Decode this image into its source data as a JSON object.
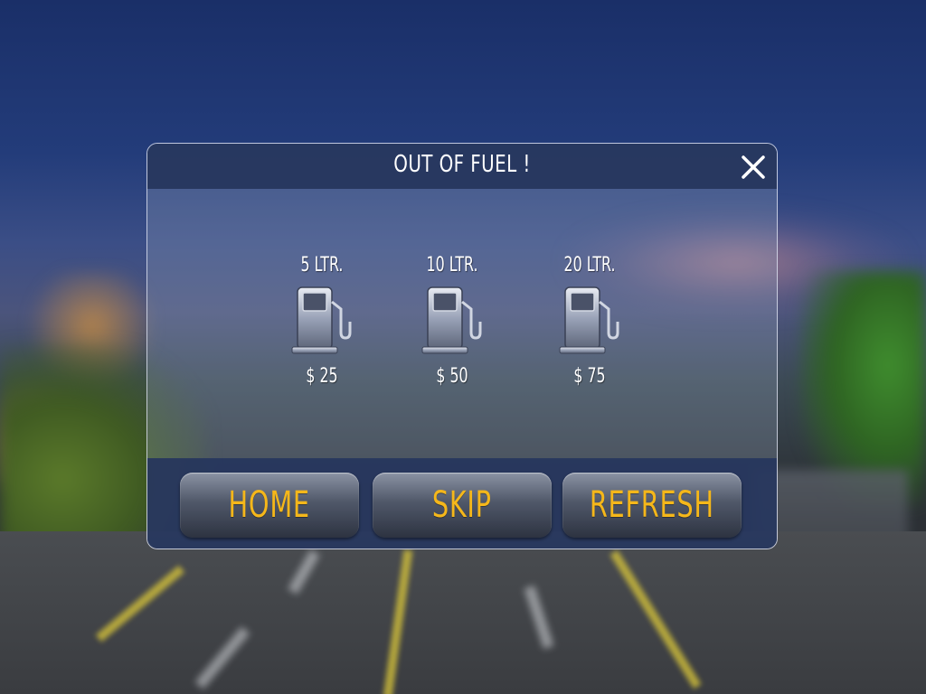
{
  "dialog": {
    "title": "OUT OF FUEL !",
    "close_icon": "close-icon"
  },
  "fuel_options": [
    {
      "label": "5 LTR.",
      "price": "$ 25",
      "icon": "fuel-pump-icon"
    },
    {
      "label": "10 LTR.",
      "price": "$ 50",
      "icon": "fuel-pump-icon"
    },
    {
      "label": "20 LTR.",
      "price": "$ 75",
      "icon": "fuel-pump-icon"
    }
  ],
  "buttons": {
    "home": "HOME",
    "skip": "SKIP",
    "refresh": "REFRESH"
  },
  "colors": {
    "button_text": "#f5b71a",
    "title_text": "#ffffff",
    "panel": "#28385f"
  }
}
